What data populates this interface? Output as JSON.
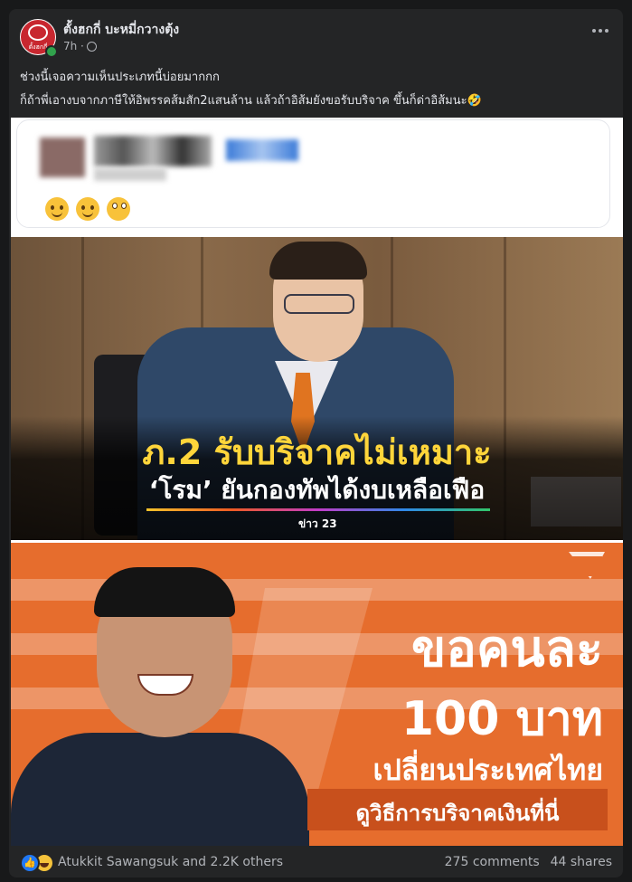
{
  "post": {
    "author": "ตั้งฮกกี่ บะหมี่กวางตุ้ง",
    "avatar_text": "ตั้งฮกกี่",
    "time": "7h ·",
    "line1": "ช่วงนี้เจอความเห็นประเภทนี้บ่อยมากกก",
    "line2": "ก็ถ้าพี่เอางบจากภาษีให้อิพรรคส้มสัก2แสนล้าน แล้วถ้าอิส้มยังขอรับบริจาค ขึ้นก็ด่าอิส้มนะ🤣",
    "more_icon": "more-horizontal-icon",
    "privacy_icon": "globe-icon"
  },
  "image": {
    "news1": {
      "headline": "ภ.2 รับบริจาคไม่เหมาะ",
      "subline": "‘โรม’ ยันกองทัพได้งบเหลือเฟือ",
      "logo": "ข่าว 23"
    },
    "news2": {
      "line1": "ขอคนละ",
      "line2": "100 บาท",
      "line3": "เปลี่ยนประเทศไทย",
      "cta": "ดูวิธีการบริจาคเงินที่นี่"
    }
  },
  "footer": {
    "reactors": "Atukkit Sawangsuk and 2.2K others",
    "comments": "275 comments",
    "shares": "44 shares"
  },
  "colors": {
    "background": "#18191a",
    "card": "#242526",
    "accent_orange": "#e66d2d",
    "headline_yellow": "#ffd53a"
  }
}
